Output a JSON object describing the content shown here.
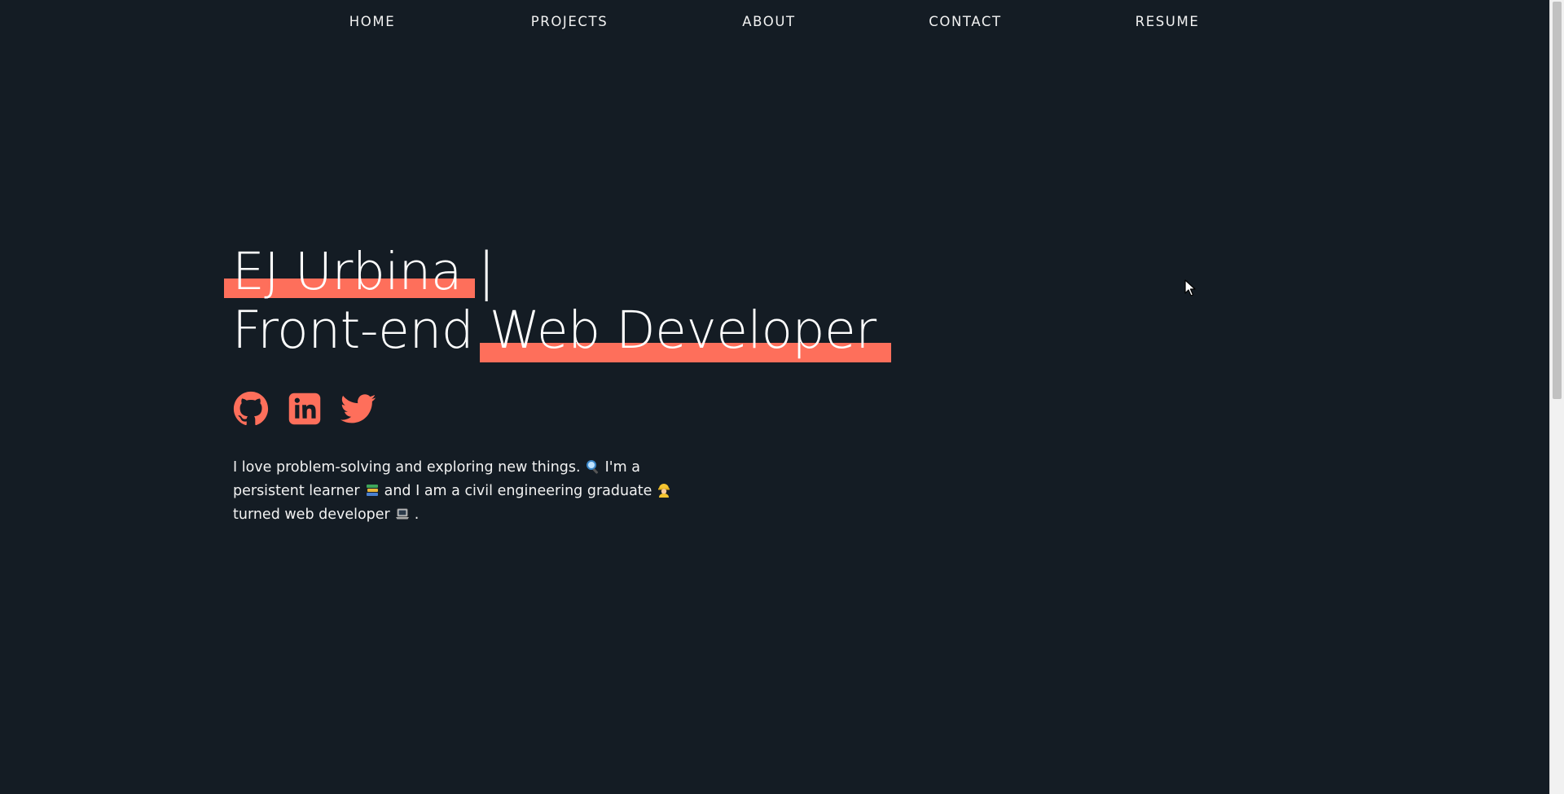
{
  "nav": {
    "items": [
      {
        "label": "HOME"
      },
      {
        "label": "PROJECTS"
      },
      {
        "label": "ABOUT"
      },
      {
        "label": "CONTACT"
      },
      {
        "label": "RESUME"
      }
    ]
  },
  "hero": {
    "name": "EJ Urbina",
    "separator": "|",
    "role_prefix": "Front-end",
    "role_highlight": "Web Developer"
  },
  "social": {
    "icons": [
      "github-icon",
      "linkedin-icon",
      "twitter-icon"
    ],
    "accent": "#fe6f5b"
  },
  "intro": {
    "part1": "I love problem-solving and exploring new things.",
    "part2": "I'm a",
    "part3": "persistent learner",
    "part4": "and I am a civil engineering graduate",
    "part5": "turned web developer",
    "part6": ".",
    "emojis": [
      "magnifying-glass-icon",
      "books-icon",
      "construction-worker-icon",
      "laptop-icon"
    ]
  },
  "colors": {
    "background": "#141c24",
    "accent": "#fe6f5b",
    "text": "#ffffff"
  }
}
